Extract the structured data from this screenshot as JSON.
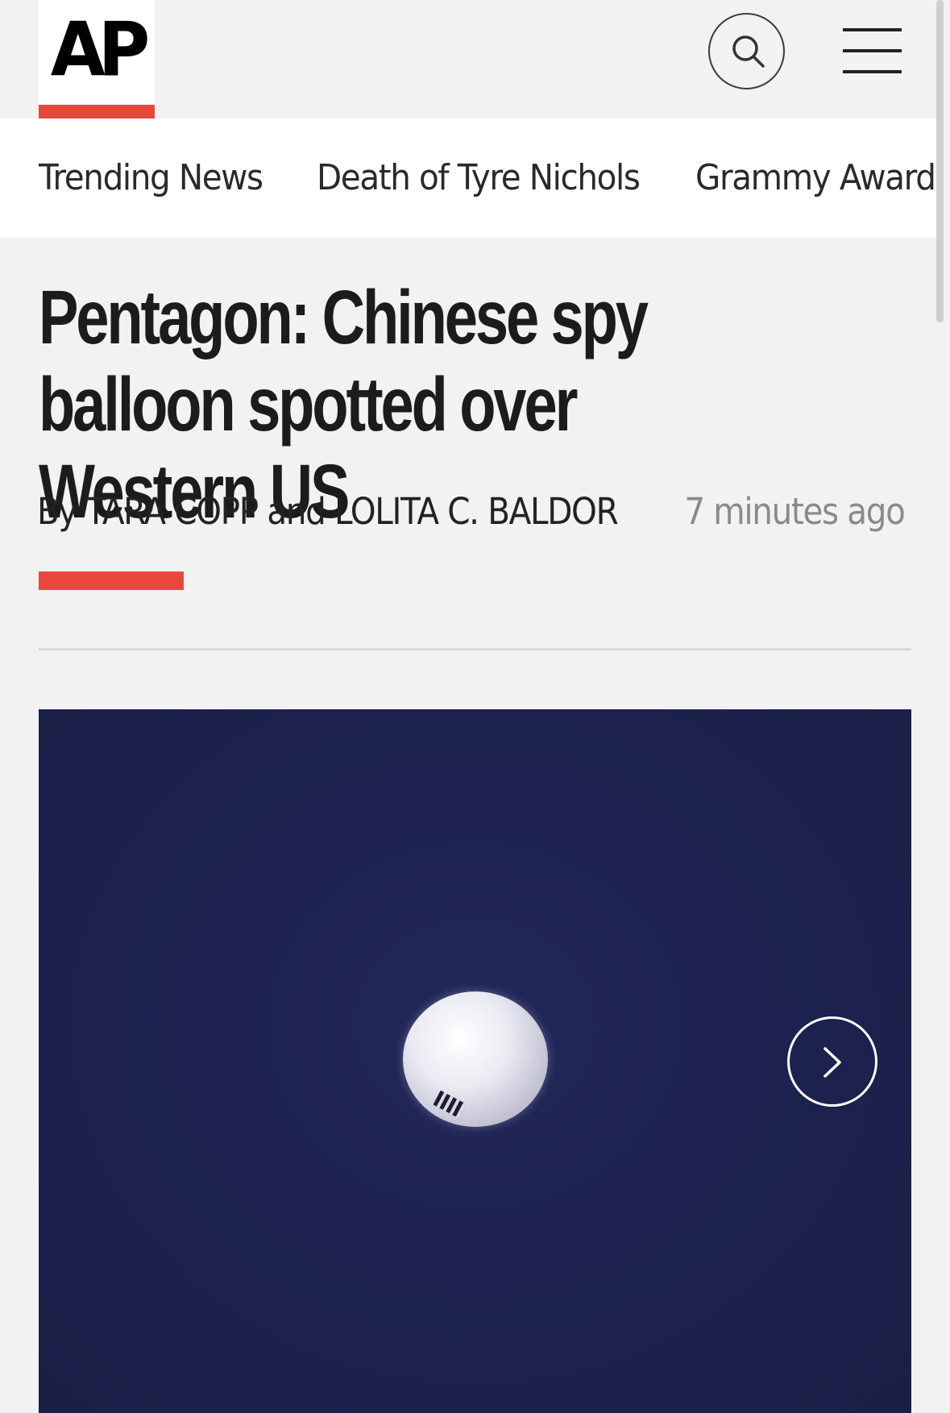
{
  "header": {
    "logo_text": "AP",
    "logo_accent_color": "#e8473d",
    "search_icon": "search-icon",
    "menu_icon": "hamburger-menu-icon"
  },
  "nav": {
    "items": [
      {
        "label": "Trending News"
      },
      {
        "label": "Death of Tyre Nichols"
      },
      {
        "label": "Grammy Awards"
      }
    ]
  },
  "article": {
    "headline": "Pentagon: Chinese spy balloon spotted over Western US",
    "byline": "By TARA COPP and LOLITA C. BALDOR",
    "timestamp": "7 minutes ago",
    "accent_color": "#e8473d"
  },
  "media": {
    "image_subject": "balloon against dark blue sky",
    "next_icon": "chevron-right-icon"
  }
}
